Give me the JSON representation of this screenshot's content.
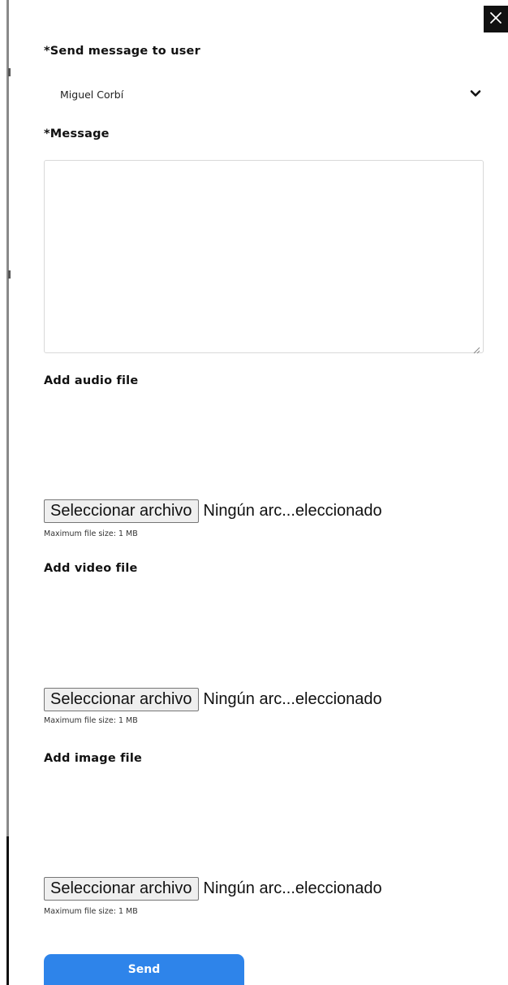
{
  "form": {
    "recipient_label": "*Send message to user",
    "recipient_value": "Miguel Corbí",
    "message_label": "*Message",
    "message_value": "",
    "audio": {
      "label": "Add audio file",
      "button": "Seleccionar archivo",
      "status": "Ningún arc...eleccionado",
      "hint": "Maximum file size: 1 MB"
    },
    "video": {
      "label": "Add video file",
      "button": "Seleccionar archivo",
      "status": "Ningún arc...eleccionado",
      "hint": "Maximum file size: 1 MB"
    },
    "image": {
      "label": "Add image file",
      "button": "Seleccionar archivo",
      "status": "Ningún arc...eleccionado",
      "hint": "Maximum file size: 1 MB"
    },
    "send_label": "Send"
  },
  "icons": {
    "close": "close-icon",
    "dropdown": "chevron-down-icon",
    "resize": "resize-handle-icon"
  },
  "colors": {
    "accent": "#2e84ea",
    "close_bg": "#111111",
    "text": "#111111"
  }
}
